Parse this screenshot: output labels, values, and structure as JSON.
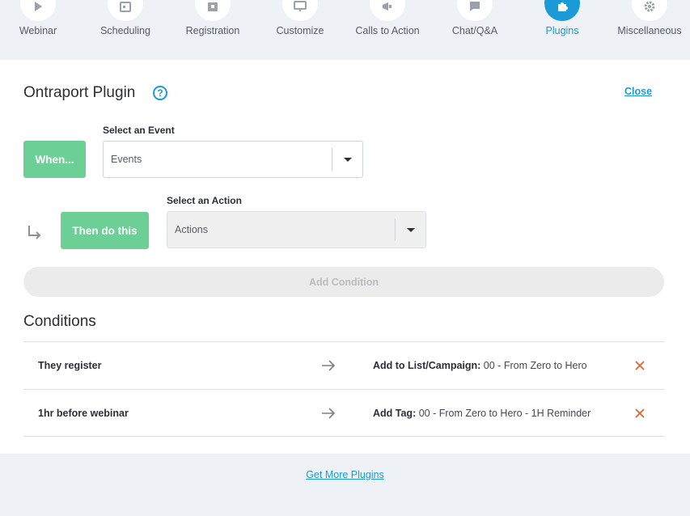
{
  "nav": {
    "items": [
      {
        "label": "Webinar",
        "icon": "play-icon"
      },
      {
        "label": "Scheduling",
        "icon": "calendar-icon"
      },
      {
        "label": "Registration",
        "icon": "registration-icon"
      },
      {
        "label": "Customize",
        "icon": "monitor-icon"
      },
      {
        "label": "Calls to Action",
        "icon": "megaphone-icon"
      },
      {
        "label": "Chat/Q&A",
        "icon": "chat-icon"
      },
      {
        "label": "Plugins",
        "icon": "puzzle-icon",
        "active": true
      },
      {
        "label": "Miscellaneous",
        "icon": "gear-icon"
      }
    ]
  },
  "plugin": {
    "title": "Ontraport Plugin",
    "help": "?",
    "close": "Close"
  },
  "event": {
    "label": "Select an Event",
    "when": "When...",
    "placeholder": "Events"
  },
  "action": {
    "label": "Select an Action",
    "then": "Then do this",
    "placeholder": "Actions"
  },
  "add_condition": "Add Condition",
  "conditions": {
    "title": "Conditions",
    "rows": [
      {
        "trigger": "They register",
        "action_label": "Add to List/Campaign:",
        "action_value": " 00 - From Zero to Hero"
      },
      {
        "trigger": "1hr before webinar",
        "action_label": "Add Tag:",
        "action_value": " 00 - From Zero to Hero - 1H Reminder"
      }
    ]
  },
  "footer": {
    "more_plugins": "Get More Plugins"
  },
  "colors": {
    "accent": "#1a9bd7",
    "green": "#6ccf95",
    "delete": "#e0652e"
  }
}
